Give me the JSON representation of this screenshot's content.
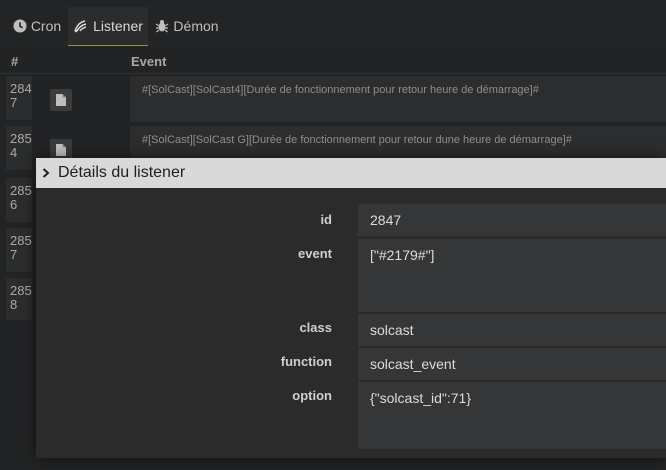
{
  "tabs": [
    {
      "label": "Cron",
      "icon": "clock-icon"
    },
    {
      "label": "Listener",
      "icon": "listener-icon"
    },
    {
      "label": "Démon",
      "icon": "bug-icon"
    }
  ],
  "table": {
    "headers": {
      "id": "#",
      "event": "Event"
    },
    "rows": [
      {
        "id_line1": "284",
        "id_line2": "7",
        "event": "#[SolCast][SolCast4][Durée de fonctionnement pour retour heure de démarrage]#"
      },
      {
        "id_line1": "285",
        "id_line2": "4",
        "event": "#[SolCast][SolCast G][Durée de fonctionnement pour retour dune heure de démarrage]#"
      },
      {
        "id_line1": "285",
        "id_line2": "6",
        "event": ""
      },
      {
        "id_line1": "285",
        "id_line2": "7",
        "event": ""
      },
      {
        "id_line1": "285",
        "id_line2": "8",
        "event": ""
      }
    ]
  },
  "modal": {
    "title": "Détails du listener",
    "fields": [
      {
        "label": "id",
        "value": "2847"
      },
      {
        "label": "event",
        "value": "[\"#2179#\"]"
      },
      {
        "label": "class",
        "value": "solcast"
      },
      {
        "label": "function",
        "value": "solcast_event"
      },
      {
        "label": "option",
        "value": "{\"solcast_id\":71}"
      }
    ]
  }
}
